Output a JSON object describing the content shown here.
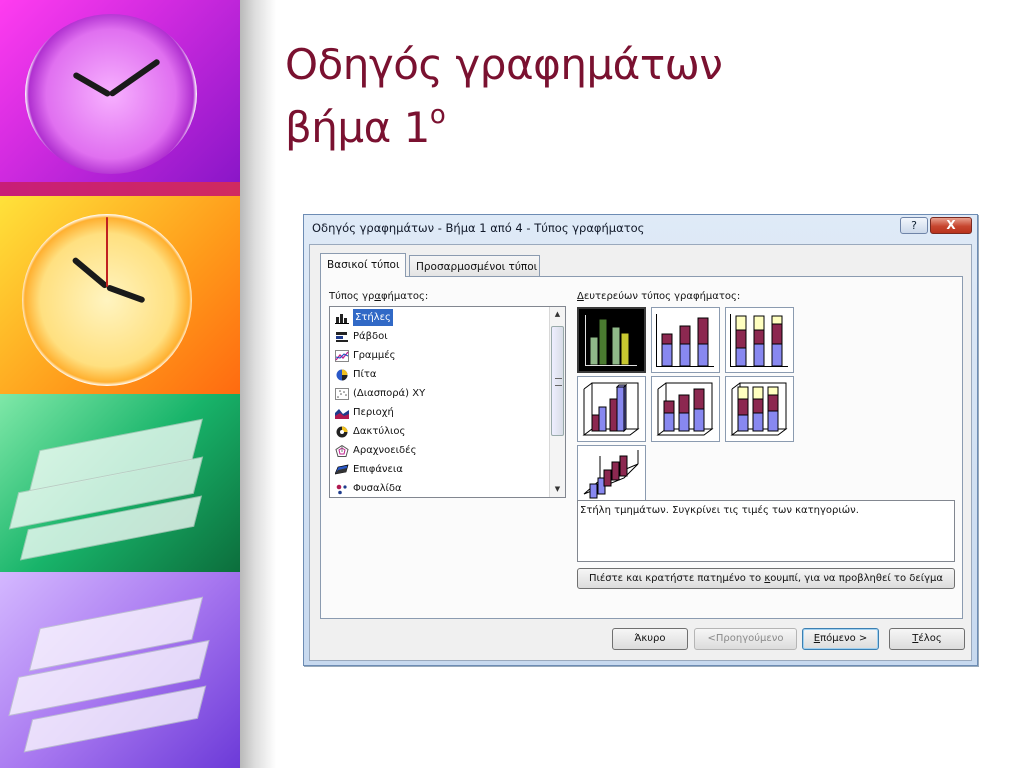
{
  "slide": {
    "title_line1": "Οδηγός γραφημάτων",
    "title_line2": "βήμα 1",
    "title_sup": "ο",
    "title_color": "#7a1130"
  },
  "dialog": {
    "title": "Οδηγός γραφημάτων - Βήμα 1 από 4 - Τύπος γραφήματος",
    "help_label": "?",
    "close_label": "X",
    "tabs": [
      {
        "label": "Βασικοί τύποι",
        "active": true
      },
      {
        "label": "Προσαρμοσμένοι τύποι",
        "active": false
      }
    ],
    "chart_type_label_pre": "Τύπος γρ",
    "chart_type_label_u": "α",
    "chart_type_label_post": "φήματος:",
    "chart_types": [
      {
        "label": "Στήλες",
        "icon": "column-chart-icon",
        "selected": true
      },
      {
        "label": "Ράβδοι",
        "icon": "bar-chart-icon"
      },
      {
        "label": "Γραμμές",
        "icon": "line-chart-icon"
      },
      {
        "label": "Πίτα",
        "icon": "pie-chart-icon"
      },
      {
        "label": "(Διασπορά) XY",
        "icon": "scatter-chart-icon"
      },
      {
        "label": "Περιοχή",
        "icon": "area-chart-icon"
      },
      {
        "label": "Δακτύλιος",
        "icon": "doughnut-chart-icon"
      },
      {
        "label": "Αραχνοειδές",
        "icon": "radar-chart-icon"
      },
      {
        "label": "Επιφάνεια",
        "icon": "surface-chart-icon"
      },
      {
        "label": "Φυσαλίδα",
        "icon": "bubble-chart-icon"
      }
    ],
    "subtype_label_u": "Δ",
    "subtype_label_rest": "ευτερεύων τύπος γραφήματος:",
    "subtypes": [
      {
        "name": "clustered-column",
        "selected": true
      },
      {
        "name": "stacked-column"
      },
      {
        "name": "100-percent-stacked-column"
      },
      {
        "name": "3d-clustered-column"
      },
      {
        "name": "3d-stacked-column"
      },
      {
        "name": "3d-100-percent-stacked-column"
      },
      {
        "name": "3d-column"
      }
    ],
    "description": "Στήλη τμημάτων. Συγκρίνει τις τιμές των κατηγοριών.",
    "preview_button_pre": "Πιέστε και κρατήστε πατημένο το ",
    "preview_button_u": "κ",
    "preview_button_post": "ουμπί, για να προβληθεί το δείγμα",
    "buttons": {
      "cancel": "Άκυρο",
      "back": "<Προηγούμενο",
      "next_u": "Ε",
      "next_rest": "πόμενο >",
      "finish_u": "Τ",
      "finish_rest": "έλος"
    }
  }
}
